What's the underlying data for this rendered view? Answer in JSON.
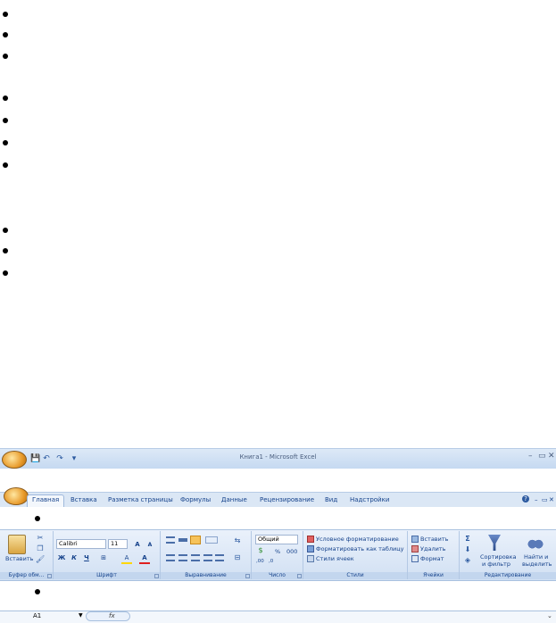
{
  "window": {
    "title": "Книга1 - Microsoft Excel",
    "minimize": "–",
    "restore": "▭",
    "close": "✕"
  },
  "qat": {
    "save": "💾",
    "undo": "↶",
    "redo": "↷",
    "more": "▾"
  },
  "tabs": [
    "Главная",
    "Вставка",
    "Разметка страницы",
    "Формулы",
    "Данные",
    "Рецензирование",
    "Вид",
    "Надстройки"
  ],
  "tabs_right": {
    "help": "?",
    "minimize": "–",
    "restore": "▭",
    "close": "✕"
  },
  "ribbon": {
    "clipboard": {
      "paste_label": "Вставить",
      "group_label": "Буфер обм...",
      "cut": "✂",
      "copy": "❐",
      "painter": "🖌"
    },
    "font": {
      "name": "Calibri",
      "size": "11",
      "grow": "A",
      "shrink": "A",
      "bold": "Ж",
      "italic": "К",
      "underline": "Ч",
      "border": "⊞",
      "fill": "A",
      "color": "A",
      "group_label": "Шрифт"
    },
    "alignment": {
      "group_label": "Выравнивание",
      "wrap": "⇆",
      "merge": "⊟"
    },
    "number": {
      "format": "Общий",
      "currency": "$",
      "percent": "%",
      "thousands": "000",
      "inc_dec": ",00",
      "dec_dec": ",0",
      "group_label": "Число"
    },
    "styles": {
      "conditional": "Условное форматирование",
      "as_table": "Форматировать как таблицу",
      "cell_styles": "Стили ячеек",
      "group_label": "Стили"
    },
    "cells": {
      "insert": "Вставить",
      "delete": "Удалить",
      "format": "Формат",
      "group_label": "Ячейки"
    },
    "editing": {
      "sum": "Σ",
      "fill": "⬇",
      "clear": "◈",
      "sort_line1": "Сортировка",
      "sort_line2": "и фильтр",
      "find_line1": "Найти и",
      "find_line2": "выделить",
      "group_label": "Редактирование"
    }
  },
  "formula_bar": {
    "name_box": "A1",
    "fx": "fx"
  },
  "colors": {
    "ribbon_bg": "#dbe7f5",
    "accent": "#15428b"
  }
}
